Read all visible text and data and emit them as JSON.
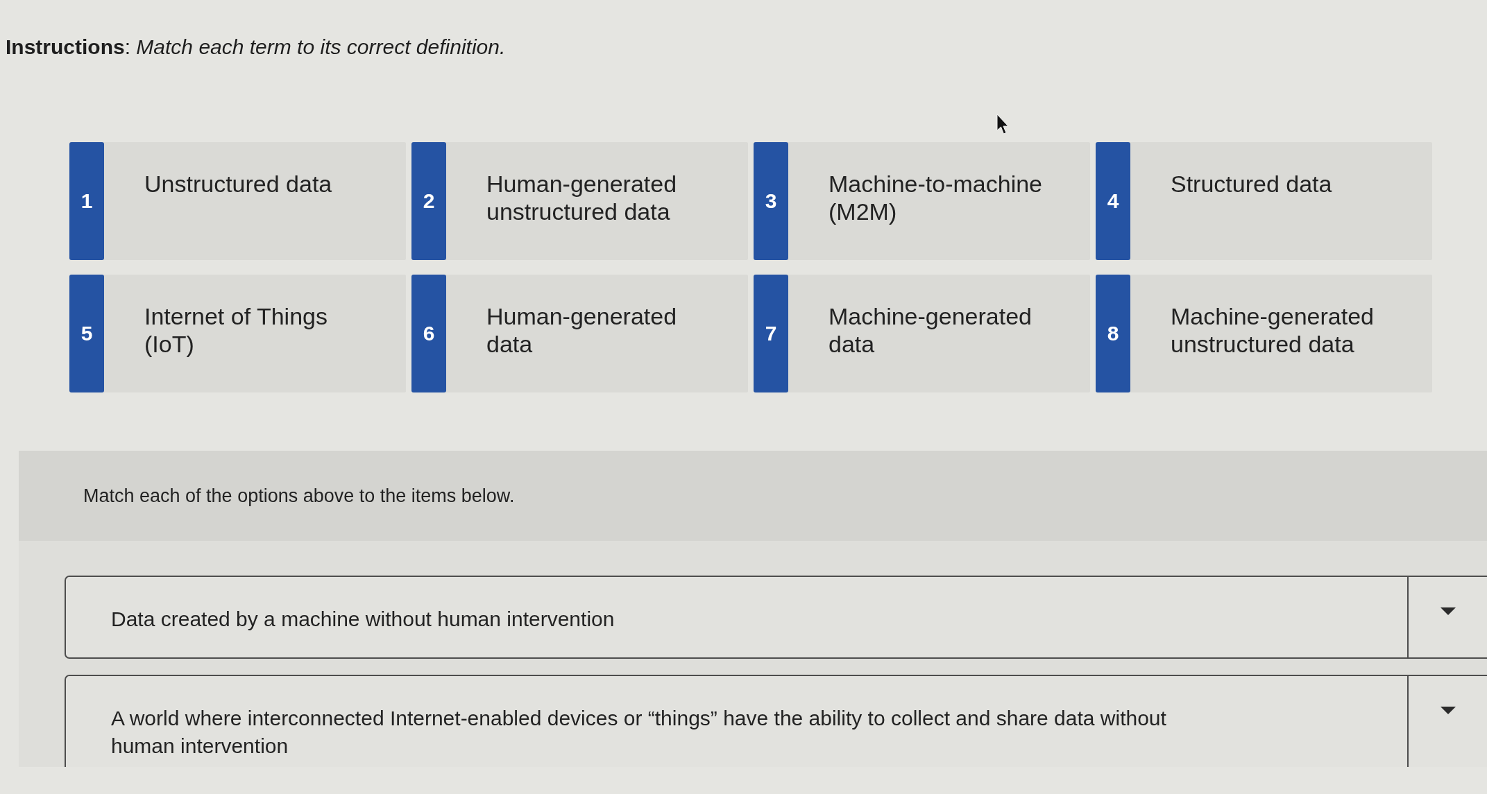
{
  "instructions": "**Instructions**: *Match each term to its correct definition.*",
  "terms": [
    {
      "number": "1",
      "label": "Unstructured data"
    },
    {
      "number": "2",
      "label": "Human-generated unstructured data"
    },
    {
      "number": "3",
      "label": "Machine-to-machine (M2M)"
    },
    {
      "number": "4",
      "label": "Structured data"
    },
    {
      "number": "5",
      "label": "Internet of Things (IoT)"
    },
    {
      "number": "6",
      "label": "Human-generated data"
    },
    {
      "number": "7",
      "label": "Machine-generated data"
    },
    {
      "number": "8",
      "label": "Machine-generated unstructured data"
    }
  ],
  "matching": {
    "prompt": "Match each of the options above to the items below.",
    "items": [
      {
        "definition": "Data created by a machine without human intervention"
      },
      {
        "definition": "A world where interconnected Internet-enabled devices or “things” have the ability to collect and share data without human intervention"
      }
    ]
  }
}
